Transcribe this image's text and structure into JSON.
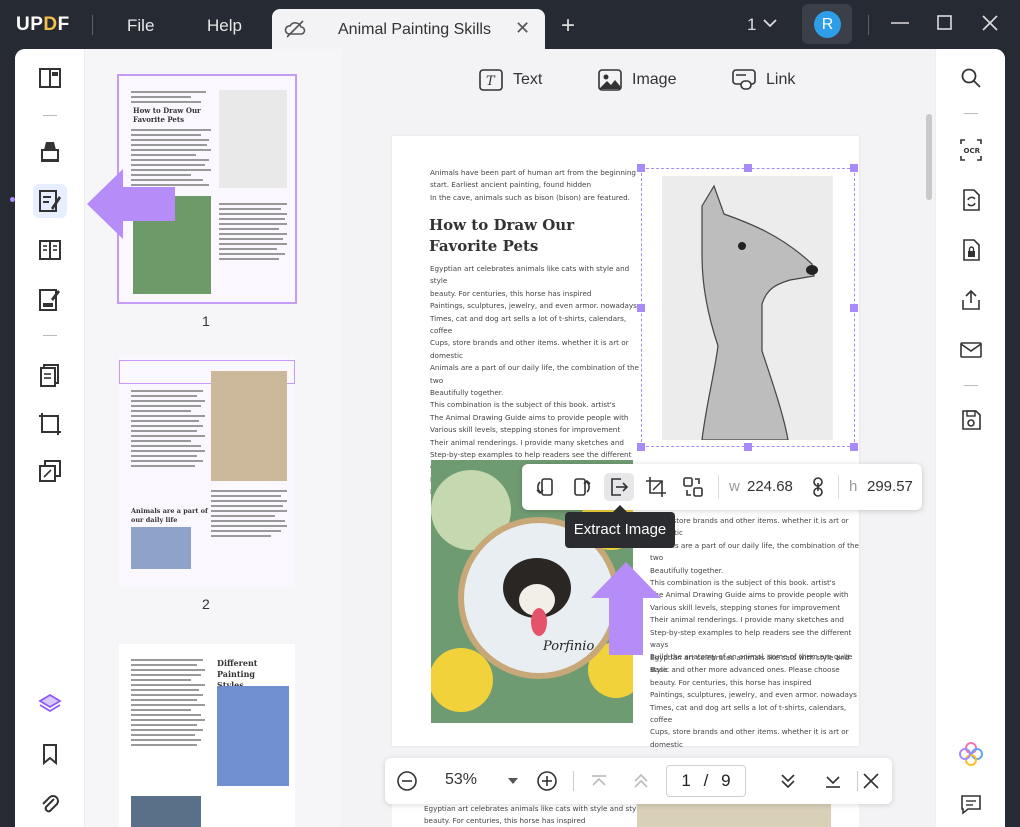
{
  "app": {
    "logo_text": "UPDF",
    "menu": [
      "File",
      "Help"
    ]
  },
  "tab": {
    "title": "Animal Painting Skills"
  },
  "window": {
    "page_count_label": "1",
    "avatar_letter": "R"
  },
  "edit_toolbar": {
    "text_label": "Text",
    "image_label": "Image",
    "link_label": "Link"
  },
  "thumbnails": [
    {
      "label": "1"
    },
    {
      "label": "2"
    }
  ],
  "thumb_texts": {
    "p1_title": "How to Draw Our\nFavorite Pets",
    "p2_heading": "Animals are a part of\nour daily life",
    "p3_heading": "Different Painting\nStyles"
  },
  "page": {
    "intro": "Animals have been part of human art from the beginning\nstart. Earliest ancient painting, found hidden\nIn the cave, animals such as bison (bison) are featured.",
    "heading": "How to Draw Our\nFavorite Pets",
    "body": "Egyptian art celebrates animals like cats with style and style\nbeauty. For centuries, this horse has inspired\nPaintings, sculptures, jewelry, and even armor. nowadays\nTimes, cat and dog art sells a lot of t-shirts, calendars, coffee\nCups, store brands and other items. whether it is art or domestic\nAnimals are a part of our daily life, the combination of the two\nBeautifully together.\nThis combination is the subject of this book. artist's\nThe Animal Drawing Guide aims to provide people with\nVarious skill levels, stepping stones for improvement\nTheir animal renderings. I provide many sketches and\nStep-by-step examples to help readers see the different ways\nBuild the anatomy of an animal. some of them are quite\nBasic and other more advanced ones. Please choose",
    "body2": "Cups, store brands and other items. whether it is art or domestic\nAnimals are a part of our daily life, the combination of the two\nBeautifully together.\nThis combination is the subject of this book. artist's\nThe Animal Drawing Guide aims to provide people with\nVarious skill levels, stepping stones for improvement\nTheir animal renderings. I provide many sketches and\nStep-by-step examples to help readers see the different ways\nBuild the anatomy of an animal. some of them are quite\nBasic and other more advanced ones. Please choose",
    "body3": "Egyptian art celebrates animals like cats with style and style\nbeauty. For centuries, this horse has inspired\nPaintings, sculptures, jewelry, and even armor. nowadays\nTimes, cat and dog art sells a lot of t-shirts, calendars, coffee\nCups, store brands and other items. whether it is art or domestic",
    "next_page_text": "Egyptian art celebrates animals like cats with style and style\nbeauty. For centuries, this horse has inspired"
  },
  "image_toolbar": {
    "width_label": "w",
    "width_value": "224.68",
    "height_label": "h",
    "height_value": "299.57",
    "tooltip": "Extract Image"
  },
  "bottom_bar": {
    "zoom": "53%",
    "current_page": "1",
    "separator": "/",
    "total_pages": "9"
  },
  "colors": {
    "accent_purple": "#a78bfa",
    "app_dark": "#262a33",
    "avatar_blue": "#2f9ee8"
  }
}
